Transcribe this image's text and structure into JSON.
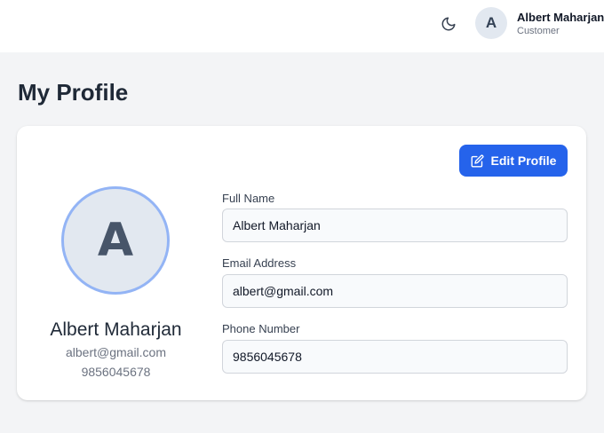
{
  "header": {
    "theme_icon": "moon-icon",
    "user": {
      "initial": "A",
      "name": "Albert Maharjan",
      "role": "Customer"
    }
  },
  "page": {
    "title": "My Profile"
  },
  "profile": {
    "edit_label": "Edit Profile",
    "edit_icon": "edit-icon",
    "avatar_initial": "A",
    "name": "Albert Maharjan",
    "email": "albert@gmail.com",
    "phone": "9856045678",
    "fields": {
      "full_name": {
        "label": "Full Name",
        "value": "Albert Maharjan"
      },
      "email": {
        "label": "Email Address",
        "value": "albert@gmail.com"
      },
      "phone": {
        "label": "Phone Number",
        "value": "9856045678"
      }
    }
  },
  "colors": {
    "accent": "#2563eb",
    "avatar_ring": "#93b4f5",
    "background": "#f3f4f6"
  }
}
